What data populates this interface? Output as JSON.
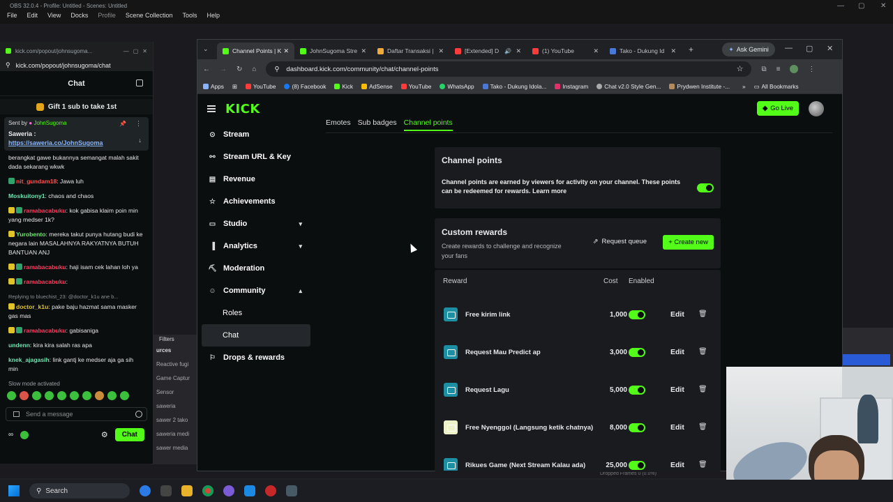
{
  "obs": {
    "title": "OBS 32.0.4 - Profile: Untitled - Scenes: Untitled",
    "menu": [
      "File",
      "Edit",
      "View",
      "Docks",
      "Profile",
      "Scene Collection",
      "Tools",
      "Help"
    ],
    "sources": [
      "Reactive fugi",
      "Game Captur",
      "Sensor",
      "saweria",
      "sawer 2 tako",
      "saweria medi",
      "sawer media"
    ],
    "sources_header": "urces",
    "filters": "Filters",
    "status": "Dropped Frames 0 (0.0%)"
  },
  "popout": {
    "url_top": "kick.com/popout/johnsugoma...",
    "url": "kick.com/popout/johnsugoma/chat",
    "chat_title": "Chat",
    "gift": "Gift 1 sub to take 1st",
    "pinned": {
      "sent_by": "Sent by",
      "user": "JohnSugoma",
      "label": "Saweria :",
      "link": "https://saweria.co/JohnSugoma"
    },
    "messages": [
      {
        "user": "",
        "text": "berangkat gawe bukannya semangat malah sakit dada sekarang wkwk",
        "color": "#e6e6e6"
      },
      {
        "user": "nit_gundam18",
        "text": ": Jawa luh",
        "color": "#ff4f4f"
      },
      {
        "user": "Moskuitony1",
        "text": ": chaos and chaos",
        "color": "#6fe3b2"
      },
      {
        "user": "ramabacabuku",
        "text": ": kok gabisa klaim poin min yang medser 1k?",
        "color": "#ff3b5c"
      },
      {
        "user": "Yurobento",
        "text": ": mereka takut punya hutang budi ke negara lain MASALAHNYA RAKYATNYA BUTUH BANTUAN ANJ",
        "color": "#6fe36f"
      },
      {
        "user": "ramabacabuku",
        "text": ": haji isam cek lahan loh ya",
        "color": "#ff3b5c"
      },
      {
        "user": "ramabacabuku",
        "text": ":",
        "color": "#ff3b5c"
      },
      {
        "user": "doctor_k1u",
        "text": ": pake baju hazmat sama masker gas mas",
        "color": "#e0c22b",
        "reply": "Replying to bluechist_23: @doctor_k1u ane b..."
      },
      {
        "user": "ramabacabuku",
        "text": ": gabisaniga",
        "color": "#ff3b5c"
      },
      {
        "user": "undenn",
        "text": ": kira kira salah ras apa",
        "color": "#6fe3b2"
      },
      {
        "user": "knek_ajagasih",
        "text": ": link gantj ke medser aja ga sih min",
        "color": "#6fe3b2"
      }
    ],
    "slow_mode": "Slow mode activated",
    "send_placeholder": "Send a message",
    "chat_button": "Chat"
  },
  "chrome": {
    "tabs": [
      {
        "label": "Channel Points | K",
        "color": "#53fc18"
      },
      {
        "label": "JohnSugoma Stre",
        "color": "#53fc18"
      },
      {
        "label": "Daftar Transaksi |",
        "color": "#f2a93b"
      },
      {
        "label": "[Extended] D",
        "color": "#ff3b3b"
      },
      {
        "label": "(1) YouTube",
        "color": "#ff3b3b"
      },
      {
        "label": "Tako - Dukung Id",
        "color": "#4a78d8"
      }
    ],
    "ask_gemini": "Ask Gemini",
    "url": "dashboard.kick.com/community/chat/channel-points",
    "bookmarks": [
      {
        "label": "Apps",
        "color": "#8ab4f8"
      },
      {
        "label": "YouTube",
        "color": "#ff3b3b"
      },
      {
        "label": "(8) Facebook",
        "color": "#1877f2"
      },
      {
        "label": "Kick",
        "color": "#53fc18"
      },
      {
        "label": "AdSense",
        "color": "#fbbc04"
      },
      {
        "label": "YouTube",
        "color": "#ff3b3b"
      },
      {
        "label": "WhatsApp",
        "color": "#25d366"
      },
      {
        "label": "Tako - Dukung Idola...",
        "color": "#4a78d8"
      },
      {
        "label": "Instagram",
        "color": "#e1306c"
      },
      {
        "label": "Chat v2.0 Style Gen...",
        "color": "#aaaaaa"
      },
      {
        "label": "Prydwen Institute -...",
        "color": "#b38b5d"
      }
    ],
    "all_bookmarks": "All Bookmarks"
  },
  "kick": {
    "logo": "KICK",
    "go_live": "Go Live",
    "nav": [
      {
        "label": "Stream",
        "icon": "⊙"
      },
      {
        "label": "Stream URL & Key",
        "icon": "⚯"
      },
      {
        "label": "Revenue",
        "icon": "▤"
      },
      {
        "label": "Achievements",
        "icon": "☆"
      },
      {
        "label": "Studio",
        "icon": "▭",
        "chevron": "▾"
      },
      {
        "label": "Analytics",
        "icon": "▐",
        "chevron": "▾"
      },
      {
        "label": "Moderation",
        "icon": "⛏"
      },
      {
        "label": "Community",
        "icon": "☺",
        "chevron": "▴"
      }
    ],
    "subnav": [
      "Roles",
      "Chat"
    ],
    "drops": "Drops & rewards",
    "tabs": [
      "Emotes",
      "Sub badges",
      "Channel points"
    ],
    "channel_points": {
      "title": "Channel points",
      "desc": "Channel points are earned by viewers for activity on your channel. These points can be redeemed for rewards.",
      "learn_more": "Learn more"
    },
    "custom_rewards": {
      "title": "Custom rewards",
      "desc": "Create rewards to challenge and recognize your fans",
      "request_queue": "Request queue",
      "create_new": "Create new"
    },
    "table": {
      "reward": "Reward",
      "cost": "Cost",
      "enabled": "Enabled"
    },
    "rewards": [
      {
        "name": "Free kirim link",
        "cost": "1,000",
        "color": "#1d8fa3"
      },
      {
        "name": "Request Mau Predict ap",
        "cost": "3,000",
        "color": "#1d8fa3"
      },
      {
        "name": "Request Lagu",
        "cost": "5,000",
        "color": "#1d8fa3"
      },
      {
        "name": "Free Nyenggol (Langsung ketik chatnya)",
        "cost": "8,000",
        "color": "#eef3c9"
      },
      {
        "name": "Rikues Game (Next Stream Kalau ada)",
        "cost": "25,000",
        "color": "#1d8fa3"
      }
    ],
    "edit_label": "Edit"
  },
  "taskbar": {
    "search": "Search"
  }
}
